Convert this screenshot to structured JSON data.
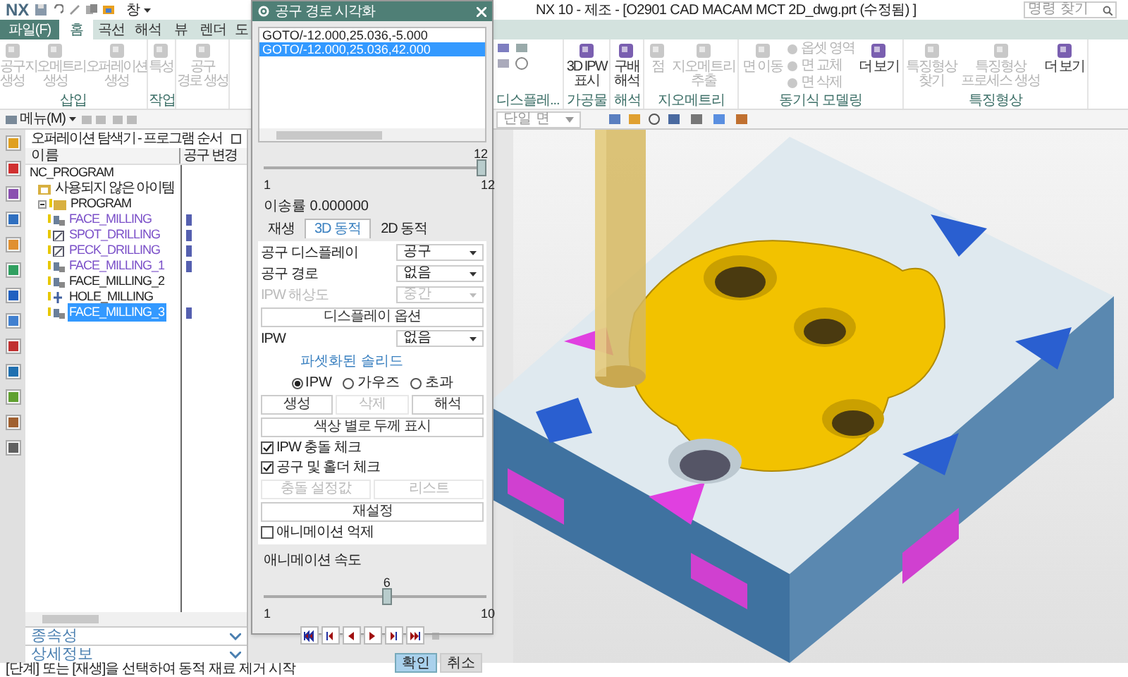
{
  "title_bar": {
    "logo": "NX",
    "window_menu": "창",
    "title": "NX 10 - 제조 - [O2901 CAD MACAM MCT 2D_dwg.prt (수정됨) ]",
    "search_placeholder": "명령 찾기"
  },
  "ribbon_tabs": [
    {
      "label": "파일(F)",
      "kind": "file",
      "selected": false
    },
    {
      "label": "홈",
      "kind": "tab",
      "selected": true
    },
    {
      "label": "곡선",
      "kind": "tab",
      "selected": false
    },
    {
      "label": "해석",
      "kind": "tab",
      "selected": false
    },
    {
      "label": "뷰",
      "kind": "tab",
      "selected": false
    },
    {
      "label": "렌더",
      "kind": "tab",
      "selected": false
    },
    {
      "label": "도",
      "kind": "tab",
      "selected": false
    }
  ],
  "ribbon_left": [
    {
      "label": "삽입",
      "items": [
        {
          "kind": "large",
          "label": "공구\n생성",
          "disabled": true
        },
        {
          "kind": "large",
          "label": "지오메트리\n생성",
          "disabled": true
        },
        {
          "kind": "large",
          "label": "오퍼레이션\n생성",
          "disabled": true
        }
      ]
    },
    {
      "label": "작업",
      "items": [
        {
          "kind": "large",
          "label": "특성",
          "disabled": true
        }
      ]
    },
    {
      "items": [
        {
          "kind": "large",
          "label": "공구\n경로 생성",
          "disabled": true
        }
      ]
    }
  ],
  "ribbon_right": [
    {
      "label": "디스플레..."
    },
    {
      "label": "가공물",
      "items": [
        {
          "kind": "large",
          "label": "3D IPW\n표시",
          "disabled": false
        }
      ]
    },
    {
      "label": "해석",
      "items": [
        {
          "kind": "large",
          "label": "구배\n해석",
          "disabled": false
        }
      ]
    },
    {
      "label": "지오메트리",
      "items": [
        {
          "kind": "large",
          "label": "점",
          "disabled": true
        },
        {
          "kind": "large",
          "label": "지오메트리\n추출",
          "disabled": true
        }
      ]
    },
    {
      "label": "동기식 모델링",
      "items": [
        {
          "kind": "large",
          "label": "면 이동",
          "disabled": true
        },
        {
          "kind": "small",
          "label": "옵셋 영역",
          "disabled": true
        },
        {
          "kind": "small",
          "label": "면 교체",
          "disabled": true
        },
        {
          "kind": "small",
          "label": "면 삭제",
          "disabled": true
        },
        {
          "kind": "large",
          "label": "더 보기",
          "disabled": false
        }
      ]
    },
    {
      "label": "특징형상",
      "items": [
        {
          "kind": "large",
          "label": "특징형상\n찾기",
          "disabled": true
        },
        {
          "kind": "large",
          "label": "특징형상\n프로세스 생성",
          "disabled": true
        },
        {
          "kind": "large",
          "label": "더 보기",
          "disabled": false
        }
      ]
    }
  ],
  "toolbar": {
    "menu": "메뉴(M)",
    "selection_filter": "단일 면"
  },
  "navigator": {
    "title": "오퍼레이션 탐색기 - 프로그램 순서",
    "columns": [
      "이름",
      "공구 변경"
    ],
    "tree": [
      {
        "label": "NC_PROGRAM",
        "kind": "root",
        "selected": false,
        "children": [
          {
            "label": "사용되지 않은 아이템",
            "kind": "folder",
            "selected": false
          },
          {
            "label": "PROGRAM",
            "kind": "program",
            "expanded": true,
            "selected": false,
            "children": [
              {
                "label": "FACE_MILLING",
                "kind": "milling",
                "generated": true,
                "tool_change": true,
                "selected": false
              },
              {
                "label": "SPOT_DRILLING",
                "kind": "drilling",
                "generated": true,
                "tool_change": true,
                "selected": false
              },
              {
                "label": "PECK_DRILLING",
                "kind": "drilling",
                "generated": true,
                "tool_change": true,
                "selected": false
              },
              {
                "label": "FACE_MILLING_1",
                "kind": "milling",
                "generated": true,
                "tool_change": true,
                "selected": false
              },
              {
                "label": "FACE_MILLING_2",
                "kind": "milling",
                "generated": false,
                "tool_change": false,
                "selected": false
              },
              {
                "label": "HOLE_MILLING",
                "kind": "hole",
                "generated": false,
                "tool_change": false,
                "selected": false
              },
              {
                "label": "FACE_MILLING_3",
                "kind": "milling",
                "generated": true,
                "tool_change": true,
                "selected": true
              }
            ]
          }
        ]
      }
    ],
    "sections": [
      {
        "label": "종속성",
        "expanded": false
      },
      {
        "label": "상세정보",
        "expanded": false
      }
    ]
  },
  "dialog": {
    "title": "공구 경로 시각화",
    "path_list": [
      {
        "text": "GOTO/-12.000,25.036,-5.000",
        "selected": false
      },
      {
        "text": "GOTO/-12.000,25.036,42.000",
        "selected": true
      }
    ],
    "step_slider": {
      "value": "12",
      "min": "1",
      "max": "12",
      "level": 1
    },
    "feed_rate": "이송률 0.000000",
    "tabs": [
      {
        "label": "재생",
        "selected": false
      },
      {
        "label": "3D 동적",
        "selected": true
      },
      {
        "label": "2D 동적",
        "selected": false
      }
    ],
    "rows": [
      {
        "kind": "dropdown",
        "label": "공구 디스플레이",
        "value": "공구",
        "disabled": false
      },
      {
        "kind": "dropdown",
        "label": "공구 경로",
        "value": "없음",
        "disabled": false
      },
      {
        "kind": "dropdown",
        "label": "IPW 해상도",
        "value": "중간",
        "disabled": true
      },
      {
        "kind": "buttons",
        "buttons": [
          {
            "label": "디스플레이 옵션",
            "disabled": false
          }
        ]
      },
      {
        "kind": "dropdown",
        "label": "IPW",
        "value": "없음",
        "disabled": false
      },
      {
        "kind": "heading",
        "label": "파셋화된 솔리드"
      },
      {
        "kind": "radios",
        "options": [
          {
            "label": "IPW",
            "selected": true
          },
          {
            "label": "가우즈",
            "selected": false
          },
          {
            "label": "초과",
            "selected": false
          }
        ]
      },
      {
        "kind": "buttons",
        "buttons": [
          {
            "label": "생성",
            "disabled": false
          },
          {
            "label": "삭제",
            "disabled": true
          },
          {
            "label": "해석",
            "disabled": false
          }
        ]
      },
      {
        "kind": "buttons",
        "buttons": [
          {
            "label": "색상 별로 두께 표시",
            "disabled": false
          }
        ]
      },
      {
        "kind": "checkbox",
        "label": "IPW 충돌 체크",
        "checked": true
      },
      {
        "kind": "checkbox",
        "label": "공구 및 홀더 체크",
        "checked": true
      },
      {
        "kind": "buttons",
        "buttons": [
          {
            "label": "충돌 설정값",
            "disabled": true
          },
          {
            "label": "리스트",
            "disabled": true
          }
        ]
      },
      {
        "kind": "buttons",
        "buttons": [
          {
            "label": "재설정",
            "disabled": false
          }
        ]
      },
      {
        "kind": "checkbox",
        "label": "애니메이션 억제",
        "checked": false
      }
    ],
    "speed_label": "애니메이션 속도",
    "speed_slider": {
      "value": "6",
      "min": "1",
      "max": "10",
      "level": 0.556
    },
    "playback": [
      {
        "kind": "rewind",
        "disabled": false
      },
      {
        "kind": "step-back",
        "disabled": false
      },
      {
        "kind": "reverse",
        "disabled": false
      },
      {
        "kind": "play",
        "disabled": false
      },
      {
        "kind": "step-forward",
        "disabled": false
      },
      {
        "kind": "fast-forward",
        "disabled": false
      },
      {
        "kind": "stop",
        "disabled": true
      }
    ],
    "actions": [
      {
        "label": "확인",
        "primary": true
      },
      {
        "label": "취소",
        "primary": false
      }
    ]
  },
  "status_bar": "[단계] 또는 [재생]을 선택하여 동적 재료 제거 시작"
}
